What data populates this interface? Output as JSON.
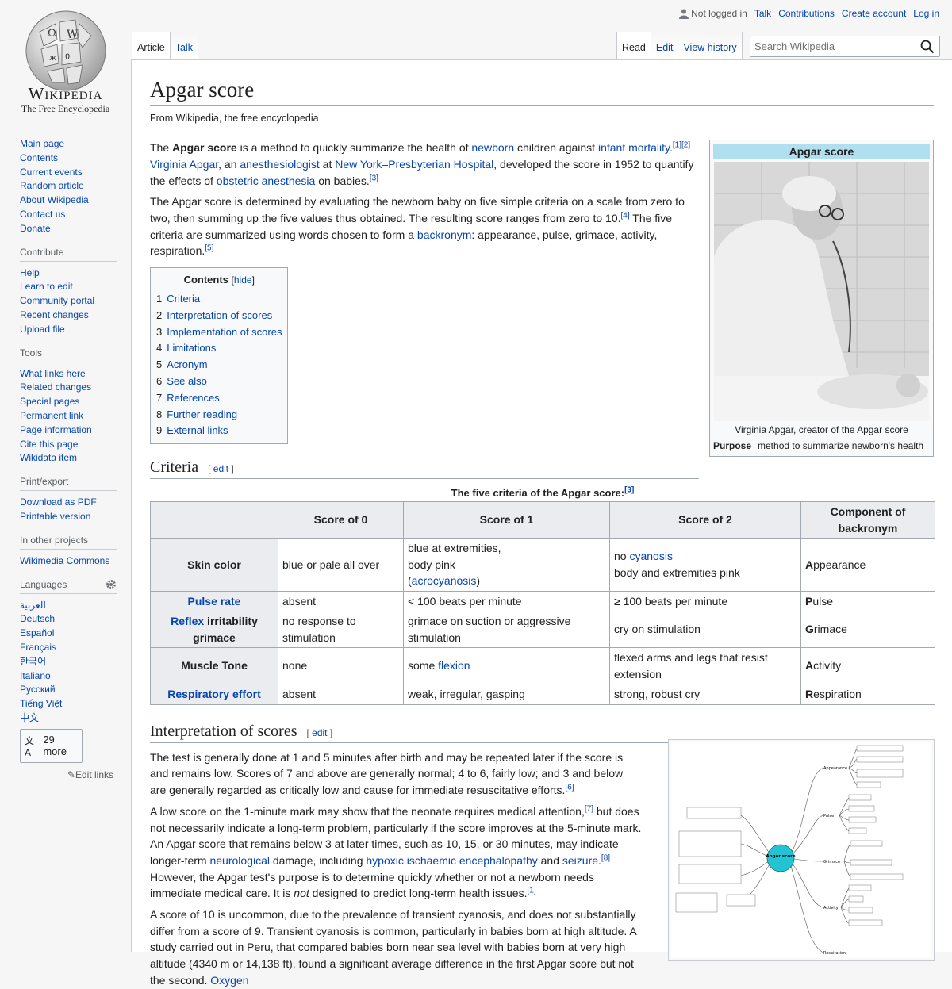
{
  "logo": {
    "title": "Wikipedia",
    "tagline": "The Free Encyclopedia"
  },
  "personal": {
    "not_logged": "Not logged in",
    "talk": "Talk",
    "contributions": "Contributions",
    "create": "Create account",
    "login": "Log in"
  },
  "tabs": {
    "article": "Article",
    "talk": "Talk",
    "read": "Read",
    "edit": "Edit",
    "history": "View history"
  },
  "search": {
    "placeholder": "Search Wikipedia"
  },
  "sidebar": {
    "nav": [
      "Main page",
      "Contents",
      "Current events",
      "Random article",
      "About Wikipedia",
      "Contact us",
      "Donate"
    ],
    "contribute": {
      "title": "Contribute",
      "items": [
        "Help",
        "Learn to edit",
        "Community portal",
        "Recent changes",
        "Upload file"
      ]
    },
    "tools": {
      "title": "Tools",
      "items": [
        "What links here",
        "Related changes",
        "Special pages",
        "Permanent link",
        "Page information",
        "Cite this page",
        "Wikidata item"
      ]
    },
    "print": {
      "title": "Print/export",
      "items": [
        "Download as PDF",
        "Printable version"
      ]
    },
    "projects": {
      "title": "In other projects",
      "items": [
        "Wikimedia Commons"
      ]
    },
    "languages": {
      "title": "Languages",
      "items": [
        "العربية",
        "Deutsch",
        "Español",
        "Français",
        "한국어",
        "Italiano",
        "Русский",
        "Tiếng Việt",
        "中文"
      ],
      "more": "29 more",
      "edit_links": "Edit links"
    }
  },
  "article": {
    "title": "Apgar score",
    "from": "From Wikipedia, the free encyclopedia",
    "infobox": {
      "title": "Apgar score",
      "caption": "Virginia Apgar, creator of the Apgar score",
      "purpose_label": "Purpose",
      "purpose": "method to summarize newborn's health"
    },
    "p1": {
      "a": "The ",
      "b": "Apgar score",
      "c": " is a method to quickly summarize the health of ",
      "newborn": "newborn",
      "d": " children against ",
      "infant": "infant mortality",
      "e": ".",
      "s1": "[1]",
      "s2": "[2]",
      "apgar": "Virginia Apgar",
      "f": ", an ",
      "anest": "anesthesiologist",
      "g": " at ",
      "nyp": "New York–Presbyterian Hospital",
      "h": ", developed the score in 1952 to quantify the effects of ",
      "obst": "obstetric anesthesia",
      "i": " on babies.",
      "s3": "[3]"
    },
    "p2": {
      "a": "The Apgar score is determined by evaluating the newborn baby on five simple criteria on a scale from zero to two, then summing up the five values thus obtained. The resulting score ranges from zero to 10.",
      "s4": "[4]",
      "b": " The five criteria are summarized using words chosen to form a ",
      "backronym": "backronym",
      "c": ": appearance, pulse, grimace, activity, respiration.",
      "s5": "[5]"
    },
    "toc": {
      "title": "Contents",
      "hide": "hide",
      "items": [
        {
          "n": "1",
          "t": "Criteria"
        },
        {
          "n": "2",
          "t": "Interpretation of scores"
        },
        {
          "n": "3",
          "t": "Implementation of scores"
        },
        {
          "n": "4",
          "t": "Limitations"
        },
        {
          "n": "5",
          "t": "Acronym"
        },
        {
          "n": "6",
          "t": "See also"
        },
        {
          "n": "7",
          "t": "References"
        },
        {
          "n": "8",
          "t": "Further reading"
        },
        {
          "n": "9",
          "t": "External links"
        }
      ]
    },
    "criteria": {
      "heading": "Criteria",
      "edit": "edit",
      "caption": "The five criteria of the Apgar score:",
      "cap_sup": "[3]",
      "headers": [
        "",
        "Score of 0",
        "Score of 1",
        "Score of 2",
        "Component of backronym"
      ]
    },
    "interp": {
      "heading": "Interpretation of scores",
      "edit": "edit",
      "p1": "The test is generally done at 1 and 5 minutes after birth and may be repeated later if the score is and remains low. Scores of 7 and above are generally normal; 4 to 6, fairly low; and 3 and below are generally regarded as critically low and cause for immediate resuscitative efforts.",
      "p1s": "[6]",
      "p2a": "A low score on the 1-minute mark may show that the neonate requires medical attention,",
      "p2s1": "[7]",
      "p2b": " but does not necessarily indicate a long-term problem, particularly if the score improves at the 5-minute mark. An Apgar score that remains below 3 at later times, such as 10, 15, or 30 minutes, may indicate longer-term ",
      "neuro": "neurological",
      "p2c": " damage, including ",
      "hie": "hypoxic ischaemic encephalopathy",
      "p2d": " and ",
      "seizure": "seizure",
      "p2e": ".",
      "p2s2": "[8]",
      "p2f": " However, the Apgar test's purpose is to determine quickly whether or not a newborn needs immediate medical care. It is ",
      "not": "not",
      "p2g": " designed to predict long-term health issues.",
      "p2s3": "[1]",
      "p3": "A score of 10 is uncommon, due to the prevalence of transient cyanosis, and does not substantially differ from a score of 9. Transient cyanosis is common, particularly in babies born at high altitude. A study carried out in Peru, that compared babies born near sea level with babies born at very high altitude (4340 m or 14,138 ft), found a significant average difference in the first Apgar score but not the second.",
      "oxygen": "Oxygen"
    },
    "diagram": {
      "center": "Apgar score",
      "labels": [
        "Appearance",
        "Pulse",
        "Grimace",
        "Activity",
        "Respiration"
      ],
      "notes": [
        "Taken on 1st min and 5th min of life and later if necessary",
        "determined by evaluating the newborn baby on five simple criteria on a scale from zero to two, then summing up the five values thus obtained",
        "Scores 3 and below are generally regarded as critically low, 4 to 6 fairly low, and 7 to 10 generally normal",
        "Heart rate, Respiratory effort, Irritability, Tone, and Color",
        "How Ready Is This Child"
      ]
    }
  }
}
